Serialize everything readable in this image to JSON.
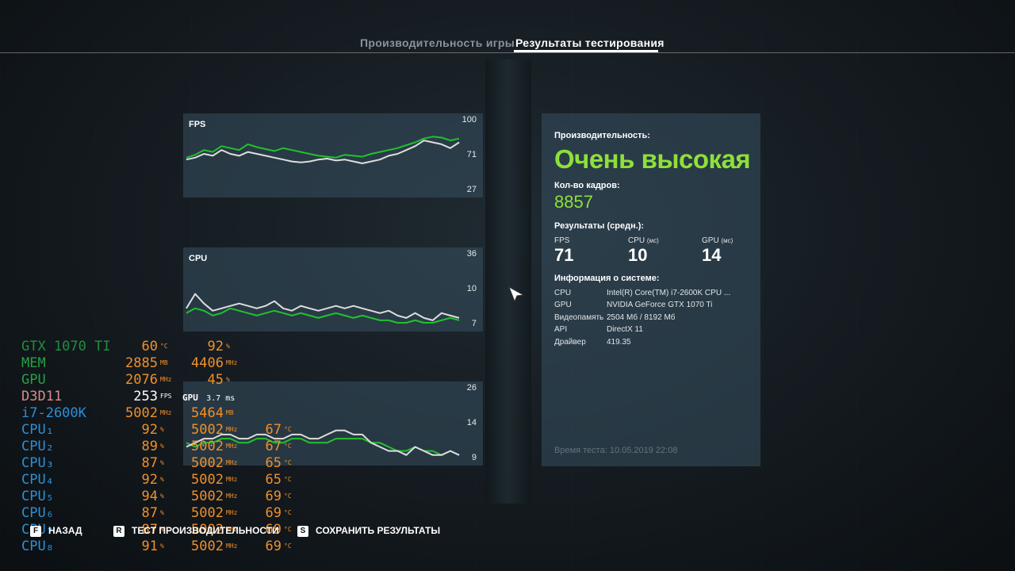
{
  "tabs": [
    {
      "label": "Производительность игры",
      "active": false
    },
    {
      "label": "Результаты тестирования",
      "active": true
    }
  ],
  "charts": [
    {
      "title": "FPS",
      "ticks": [
        "100",
        "71",
        "27"
      ]
    },
    {
      "title": "CPU",
      "ticks": [
        "36",
        "10",
        "7"
      ]
    },
    {
      "title": "GPU",
      "ticks": [
        "26",
        "14",
        "9"
      ]
    }
  ],
  "chart_data": [
    {
      "type": "line",
      "title": "FPS",
      "ylim": [
        27,
        100
      ],
      "series": [
        {
          "name": "",
          "color": "#22c12e",
          "values": [
            62,
            65,
            70,
            68,
            74,
            72,
            70,
            76,
            73,
            71,
            69,
            72,
            70,
            68,
            66,
            64,
            63,
            62,
            65,
            64,
            63,
            66,
            68,
            70,
            72,
            75,
            78,
            82,
            84,
            83,
            80,
            82
          ]
        },
        {
          "name": "",
          "color": "#dddddd",
          "values": [
            60,
            62,
            66,
            64,
            70,
            66,
            64,
            68,
            66,
            64,
            62,
            60,
            58,
            57,
            58,
            60,
            61,
            59,
            60,
            58,
            56,
            58,
            60,
            64,
            66,
            70,
            74,
            80,
            78,
            76,
            72,
            78
          ]
        }
      ]
    },
    {
      "type": "line",
      "title": "CPU",
      "ylim": [
        7,
        36
      ],
      "series": [
        {
          "name": "",
          "color": "#22c12e",
          "values": [
            12,
            14,
            13,
            11,
            12,
            14,
            13,
            12,
            11,
            12,
            13,
            12,
            11,
            12,
            11,
            10,
            11,
            12,
            11,
            10,
            11,
            10,
            9,
            9,
            8,
            8,
            9,
            8,
            8,
            9,
            10,
            9
          ]
        },
        {
          "name": "",
          "color": "#dddddd",
          "values": [
            14,
            20,
            16,
            13,
            14,
            15,
            16,
            15,
            14,
            15,
            17,
            14,
            13,
            15,
            14,
            13,
            14,
            15,
            14,
            15,
            14,
            13,
            12,
            13,
            11,
            10,
            12,
            10,
            9,
            12,
            11,
            10
          ]
        }
      ]
    },
    {
      "type": "line",
      "title": "GPU",
      "ylim": [
        9,
        26
      ],
      "series": [
        {
          "name": "",
          "color": "#22c12e",
          "values": [
            13,
            12,
            13,
            13,
            14,
            14,
            13,
            13,
            14,
            14,
            13,
            13,
            14,
            14,
            13,
            13,
            13,
            14,
            14,
            14,
            14,
            13,
            13,
            12,
            11,
            11,
            12,
            11,
            11,
            10,
            11,
            10
          ]
        },
        {
          "name": "",
          "color": "#dddddd",
          "values": [
            12,
            13,
            14,
            14,
            15,
            15,
            14,
            14,
            15,
            15,
            14,
            14,
            15,
            15,
            14,
            14,
            15,
            16,
            16,
            15,
            15,
            13,
            12,
            11,
            11,
            10,
            12,
            11,
            10,
            10,
            11,
            10
          ]
        }
      ]
    }
  ],
  "results": {
    "perf_label": "Производительность:",
    "perf_value": "Очень высокая",
    "frames_label": "Кол-во кадров:",
    "frames_value": "8857",
    "avg_label": "Результаты (средн.):",
    "avg": [
      {
        "label": "FPS",
        "value": "71"
      },
      {
        "label": "CPU",
        "unit": "(мс)",
        "value": "10"
      },
      {
        "label": "GPU",
        "unit": "(мс)",
        "value": "14"
      }
    ],
    "sys_label": "Информация о системе:",
    "sys": [
      {
        "key": "CPU",
        "value": "Intel(R) Core(TM) i7-2600K CPU ..."
      },
      {
        "key": "GPU",
        "value": "NVIDIA GeForce GTX 1070 Ti"
      },
      {
        "key": "Видеопамять",
        "value": "2504 Мб / 8192 Мб"
      },
      {
        "key": "API",
        "value": "DirectX 11"
      },
      {
        "key": "Драйвер",
        "value": "419.35"
      }
    ],
    "test_time": "Время теста: 10.05.2019 22:08"
  },
  "osd": {
    "gtx": {
      "label": "GTX 1070 TI",
      "temp": "60",
      "temp_unit": "°C",
      "load": "92",
      "load_unit": "%"
    },
    "mem": {
      "label": "MEM",
      "v1": "2885",
      "u1": "MB",
      "v2": "4406",
      "u2": "MHz"
    },
    "gpu": {
      "label": "GPU",
      "v1": "2076",
      "u1": "MHz",
      "v2": "45",
      "u2": "%"
    },
    "d3d": {
      "label": "D3D11",
      "fps": "253",
      "fps_unit": "FPS",
      "ft_label": "GPU",
      "ft": "3.7 ms"
    },
    "cpu": {
      "label": "i7-2600K",
      "v1": "5002",
      "u1": "MHz",
      "v2": "5464",
      "u2": "MB"
    },
    "cores": [
      {
        "label": "CPU₁",
        "load": "92",
        "mhz": "5002",
        "temp": "67"
      },
      {
        "label": "CPU₂",
        "load": "89",
        "mhz": "5002",
        "temp": "67"
      },
      {
        "label": "CPU₃",
        "load": "87",
        "mhz": "5002",
        "temp": "65"
      },
      {
        "label": "CPU₄",
        "load": "92",
        "mhz": "5002",
        "temp": "65"
      },
      {
        "label": "CPU₅",
        "load": "94",
        "mhz": "5002",
        "temp": "69"
      },
      {
        "label": "CPU₆",
        "load": "87",
        "mhz": "5002",
        "temp": "69"
      },
      {
        "label": "CPU₇",
        "load": "87",
        "mhz": "5002",
        "temp": "69"
      },
      {
        "label": "CPU₈",
        "load": "91",
        "mhz": "5002",
        "temp": "69"
      }
    ],
    "unit_pct": "%",
    "unit_mhz": "MHz",
    "unit_c": "°C"
  },
  "bottom_bar": [
    {
      "key": "F",
      "label": "НАЗАД"
    },
    {
      "key": "R",
      "label": "ТЕСТ ПРОИЗВОДИТЕЛЬНОСТИ"
    },
    {
      "key": "S",
      "label": "СОХРАНИТЬ РЕЗУЛЬТАТЫ"
    }
  ]
}
